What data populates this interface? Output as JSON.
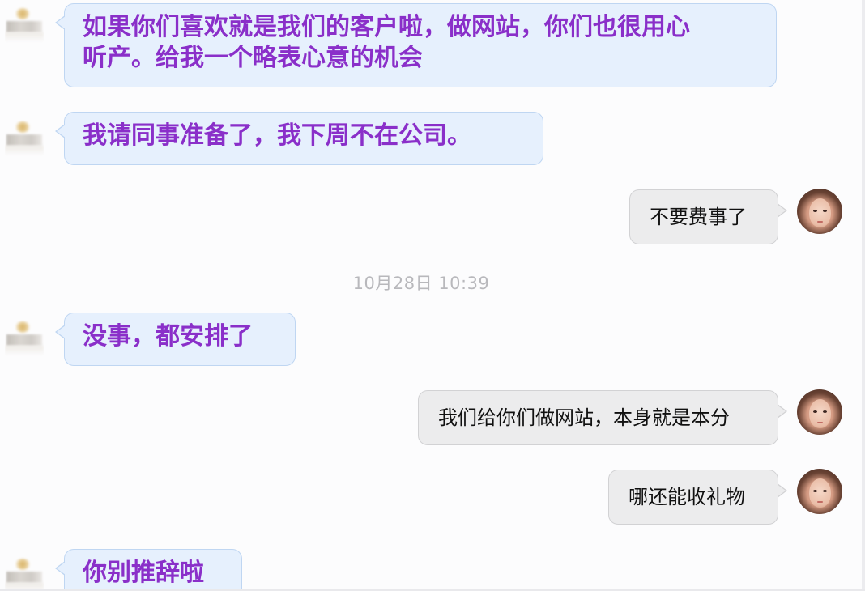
{
  "messages": [
    {
      "sender": "contact",
      "lines": [
        "如果你们喜欢就是我们的客户啦，做网站，你们也很用心",
        "听产。给我一个略表心意的机会"
      ]
    },
    {
      "sender": "contact",
      "text": "我请同事准备了，我下周不在公司。"
    },
    {
      "sender": "self",
      "text": "不要费事了"
    },
    {
      "sender": "contact",
      "text": "没事，都安排了"
    },
    {
      "sender": "self",
      "text": "我们给你们做网站，本身就是本分"
    },
    {
      "sender": "self",
      "text": "哪还能收礼物"
    },
    {
      "sender": "contact",
      "text": "你别推辞啦"
    }
  ],
  "timestamp": "10月28日  10:39",
  "colors": {
    "contact_text": "#8a2fc9",
    "contact_bubble": "#e6f0fd",
    "self_bubble": "#ececed",
    "timestamp_text": "#b8b8bc"
  }
}
